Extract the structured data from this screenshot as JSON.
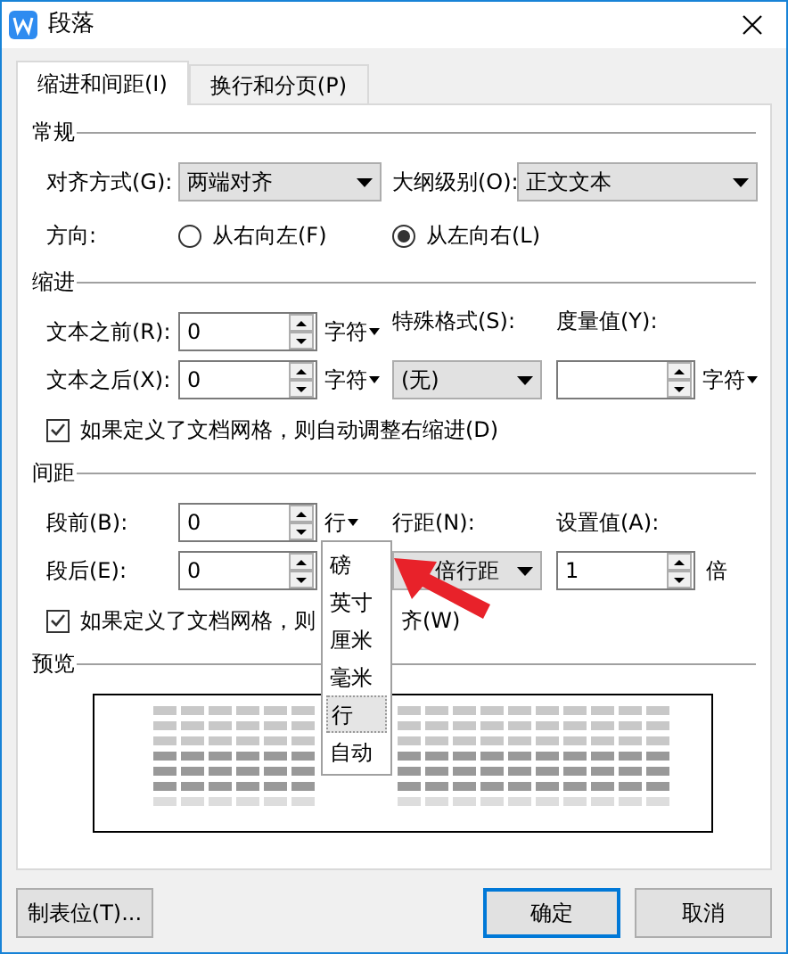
{
  "window": {
    "title": "段落"
  },
  "tabs": [
    {
      "label": "缩进和间距(I)",
      "selected": true
    },
    {
      "label": "换行和分页(P)",
      "selected": false
    }
  ],
  "general": {
    "heading": "常规",
    "alignment": {
      "label": "对齐方式(G):",
      "value": "两端对齐"
    },
    "outline_level": {
      "label": "大纲级别(O):",
      "value": "正文文本"
    },
    "direction": {
      "label": "方向:",
      "options": [
        {
          "label": "从右向左(F)",
          "selected": false
        },
        {
          "label": "从左向右(L)",
          "selected": true
        }
      ]
    }
  },
  "indent": {
    "heading": "缩进",
    "before": {
      "label": "文本之前(R):",
      "value": "0",
      "unit": "字符"
    },
    "after": {
      "label": "文本之后(X):",
      "value": "0",
      "unit": "字符"
    },
    "special": {
      "label": "特殊格式(S):",
      "value": "(无)"
    },
    "measure": {
      "label": "度量值(Y):",
      "unit": "字符"
    },
    "auto_adjust": {
      "label": "如果定义了文档网格，则自动调整右缩进(D)",
      "checked": true
    }
  },
  "spacing": {
    "heading": "间距",
    "before": {
      "label": "段前(B):",
      "value": "0",
      "unit": "行"
    },
    "after": {
      "label": "段后(E):",
      "value": "0"
    },
    "line_spacing": {
      "label": "行距(N):",
      "value": "倍行距"
    },
    "set_value": {
      "label": "设置值(A):",
      "value": "1",
      "unit": "倍"
    },
    "snap_grid": {
      "label": "如果定义了文档网格，则",
      "label_tail": "齐(W)",
      "checked": true
    }
  },
  "unit_menu": {
    "items": [
      {
        "label": "磅",
        "selected": false
      },
      {
        "label": "英寸",
        "selected": false
      },
      {
        "label": "厘米",
        "selected": false
      },
      {
        "label": "毫米",
        "selected": false
      },
      {
        "label": "行",
        "selected": true
      },
      {
        "label": "自动",
        "selected": false
      }
    ]
  },
  "preview": {
    "heading": "预览"
  },
  "buttons": {
    "tabs": "制表位(T)...",
    "ok": "确定",
    "cancel": "取消"
  }
}
